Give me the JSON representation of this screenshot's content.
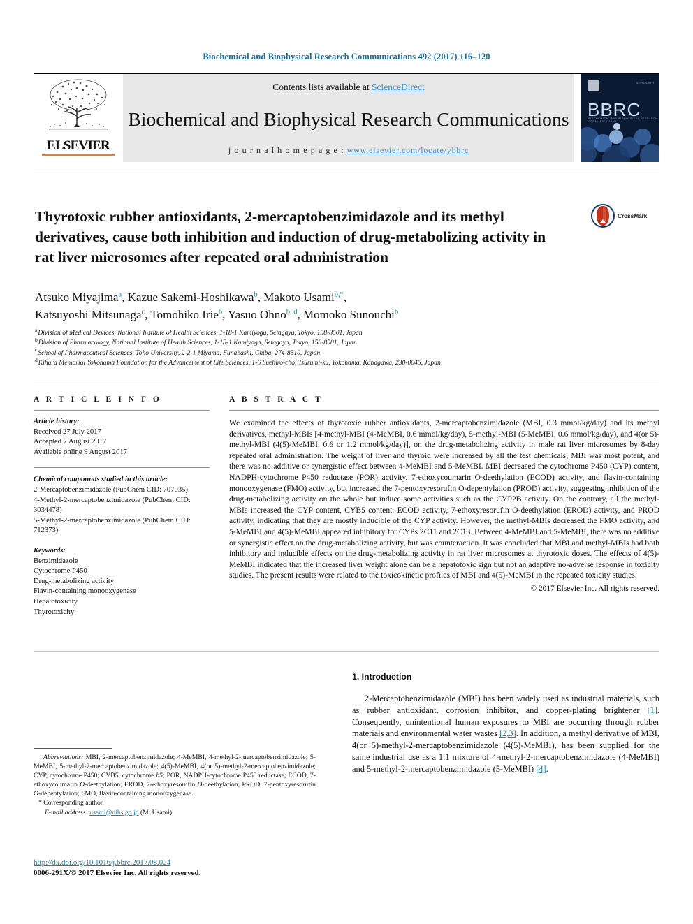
{
  "running_head": "Biochemical and Biophysical Research Communications 492 (2017) 116–120",
  "masthead": {
    "contents_prefix": "Contents lists available at ",
    "sciencedirect": "ScienceDirect",
    "journal_title": "Biochemical and Biophysical Research Communications",
    "homepage_prefix": "j o u r n a l   h o m e p a g e :   ",
    "homepage_url": "www.elsevier.com/locate/ybbrc",
    "publisher": "ELSEVIER",
    "cover_word": "BBRC",
    "cover_sub": "BIOCHEMICAL AND BIOPHYSICAL RESEARCH COMMUNICATIONS",
    "cover_corner": "ScienceDirect"
  },
  "crossmark": {
    "label": "CrossMark"
  },
  "title": "Thyrotoxic rubber antioxidants, 2-mercaptobenzimidazole and its methyl derivatives, cause both inhibition and induction of drug-metabolizing activity in rat liver microsomes after repeated oral administration",
  "authors": [
    {
      "name": "Atsuko Miyajima",
      "marks": "a",
      "corr": false
    },
    {
      "name": "Kazue Sakemi-Hoshikawa",
      "marks": "b",
      "corr": false
    },
    {
      "name": "Makoto Usami",
      "marks": "b",
      "corr": true
    },
    {
      "name": "Katsuyoshi Mitsunaga",
      "marks": "c",
      "corr": false
    },
    {
      "name": "Tomohiko Irie",
      "marks": "b",
      "corr": false
    },
    {
      "name": "Yasuo Ohno",
      "marks": "b, d",
      "corr": false
    },
    {
      "name": "Momoko Sunouchi",
      "marks": "b",
      "corr": false
    }
  ],
  "affiliations": [
    {
      "mark": "a",
      "text": "Division of Medical Devices, National Institute of Health Sciences, 1-18-1 Kamiyoga, Setagaya, Tokyo, 158-8501, Japan"
    },
    {
      "mark": "b",
      "text": "Division of Pharmacology, National Institute of Health Sciences, 1-18-1 Kamiyoga, Setagaya, Tokyo, 158-8501, Japan"
    },
    {
      "mark": "c",
      "text": "School of Pharmaceutical Sciences, Toho University, 2-2-1 Miyama, Funabashi, Chiba, 274-8510, Japan"
    },
    {
      "mark": "d",
      "text": "Kihara Memorial Yokohama Foundation for the Advancement of Life Sciences, 1-6 Suehiro-cho, Tsurumi-ku, Yokohama, Kanagawa, 230-0045, Japan"
    }
  ],
  "article_info": {
    "heading": "A R T I C L E   I N F O",
    "history_label": "Article history:",
    "history": [
      "Received 27 July 2017",
      "Accepted 7 August 2017",
      "Available online 9 August 2017"
    ],
    "compounds_label": "Chemical compounds studied in this article:",
    "compounds": [
      "2-Mercaptobenzimidazole (PubChem CID: 707035)",
      "4-Methyl-2-mercaptobenzimidazole (PubChem CID: 3034478)",
      "5-Methyl-2-mercaptobenzimidazole (PubChem CID: 712373)"
    ],
    "keywords_label": "Keywords:",
    "keywords": [
      "Benzimidazole",
      "Cytochrome P450",
      "Drug-metabolizing activity",
      "Flavin-containing monooxygenase",
      "Hepatotoxicity",
      "Thyrotoxicity"
    ]
  },
  "abstract": {
    "heading": "A B S T R A C T",
    "body": "We examined the effects of thyrotoxic rubber antioxidants, 2-mercaptobenzimidazole (MBI, 0.3 mmol/kg/day) and its methyl derivatives, methyl-MBIs [4-methyl-MBI (4-MeMBI, 0.6 mmol/kg/day), 5-methyl-MBI (5-MeMBI, 0.6 mmol/kg/day), and 4(or 5)-methyl-MBI (4(5)-MeMBI, 0.6 or 1.2 mmol/kg/day)], on the drug-metabolizing activity in male rat liver microsomes by 8-day repeated oral administration. The weight of liver and thyroid were increased by all the test chemicals; MBI was most potent, and there was no additive or synergistic effect between 4-MeMBI and 5-MeMBI. MBI decreased the cytochrome P450 (CYP) content, NADPH-cytochrome P450 reductase (POR) activity, 7-ethoxycoumarin O-deethylation (ECOD) activity, and flavin-containing monooxygenase (FMO) activity, but increased the 7-pentoxyresorufin O-depentylation (PROD) activity, suggesting inhibition of the drug-metabolizing activity on the whole but induce some activities such as the CYP2B activity. On the contrary, all the methyl-MBIs increased the CYP content, CYB5 content, ECOD activity, 7-ethoxyresorufin O-deethylation (EROD) activity, and PROD activity, indicating that they are mostly inducible of the CYP activity. However, the methyl-MBIs decreased the FMO activity, and 5-MeMBI and 4(5)-MeMBI appeared inhibitory for CYPs 2C11 and 2C13. Between 4-MeMBI and 5-MeMBI, there was no additive or synergistic effect on the drug-metabolizing activity, but was counteraction. It was concluded that MBI and methyl-MBIs had both inhibitory and inducible effects on the drug-metabolizing activity in rat liver microsomes at thyrotoxic doses. The effects of 4(5)-MeMBI indicated that the increased liver weight alone can be a hepatotoxic sign but not an adaptive no-adverse response in toxicity studies. The present results were related to the toxicokinetic profiles of MBI and 4(5)-MeMBI in the repeated toxicity studies.",
    "copyright": "© 2017 Elsevier Inc. All rights reserved."
  },
  "introduction": {
    "heading": "1.  Introduction",
    "p1_a": "2-Mercaptobenzimidazole (MBI) has been widely used as industrial materials, such as rubber antioxidant, corrosion inhibitor, and copper-plating brightener ",
    "ref1": "[1]",
    "p1_b": ". Consequently, unintentional human exposures to MBI are occurring through rubber materials and environmental water wastes ",
    "ref2": "[2,3]",
    "p1_c": ". In addition, a methyl derivative of MBI, 4(or 5)-methyl-2-mercaptobenzimidazole (4(5)-MeMBI), has been supplied for the same industrial use as a 1:1 mixture of 4-methyl-2-mercaptobenzimidazole (4-MeMBI) and 5-methyl-2-mercaptobenzimidazole (5-MeMBI) ",
    "ref3": "[4]",
    "p1_d": "."
  },
  "footnotes": {
    "abbrev_label": "Abbreviations:",
    "abbrev_text": " MBI, 2-mercaptobenzimidazole; 4-MeMBI, 4-methyl-2-mercaptobenzimidazole; 5-MeMBI, 5-methyl-2-mercaptobenzimidazole; 4(5)-MeMBI, 4(or 5)-methyl-2-mercaptobenzimidazole; CYP, cytochrome P450; CYB5, cytochrome ",
    "abbrev_text_b5": "b5",
    "abbrev_text2": "; POR, NADPH-cytochrome P450 reductase; ECOD, 7-ethoxycoumarin ",
    "o1": "O",
    "abbrev_text3": "-deethylation; EROD, 7-ethoxyresorufin ",
    "o2": "O",
    "abbrev_text4": "-deethylation; PROD, 7-pentoxyresorufin ",
    "o3": "O",
    "abbrev_text5": "-depentylation; FMO, flavin-containing monooxygenase.",
    "corresponding": "Corresponding author.",
    "email_label": "E-mail address:",
    "email": "usami@nihs.go.jp",
    "email_suffix": " (M. Usami).",
    "doi": "http://dx.doi.org/10.1016/j.bbrc.2017.08.024",
    "issn": "0006-291X/© 2017 Elsevier Inc. All rights reserved."
  },
  "colors": {
    "link": "#1a7bb5",
    "running_head": "#1a6ea8",
    "elsevier_orange": "#f47c20",
    "band_gray": "#e8e8e8",
    "cover_navy": "#0a1a33"
  }
}
